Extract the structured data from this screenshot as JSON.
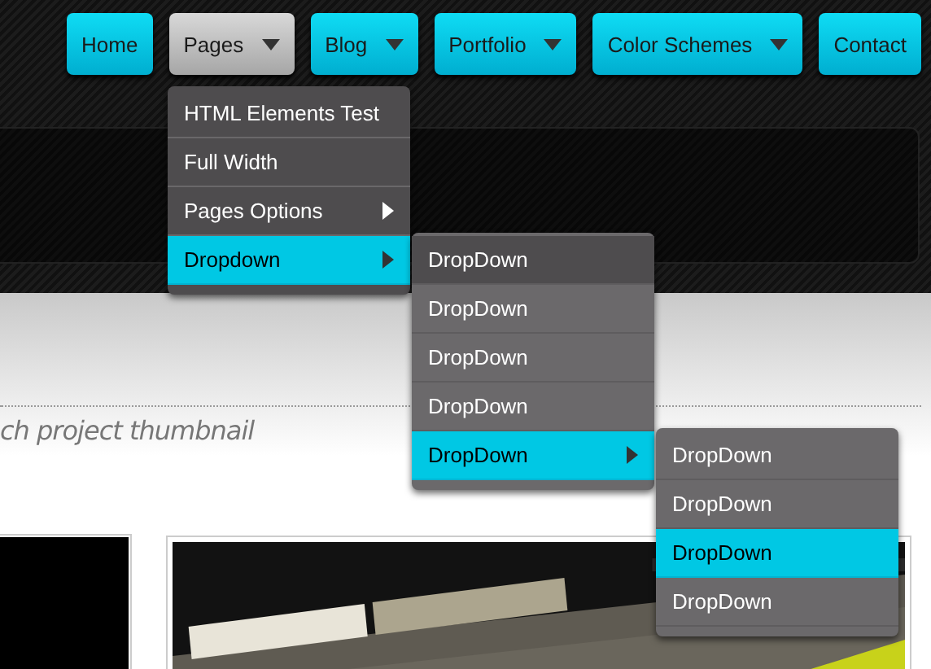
{
  "nav": [
    {
      "label": "Home",
      "selected": false,
      "has_dropdown": false
    },
    {
      "label": "Pages",
      "selected": true,
      "has_dropdown": true,
      "children": [
        {
          "label": "HTML Elements Test",
          "selected": false
        },
        {
          "label": "Full Width",
          "selected": false
        },
        {
          "label": "Pages Options",
          "selected": false,
          "has_submenu": true
        },
        {
          "label": "Dropdown",
          "selected": true,
          "children": [
            {
              "label": "DropDown",
              "selected": false
            },
            {
              "label": "DropDown",
              "selected": false
            },
            {
              "label": "DropDown",
              "selected": false
            },
            {
              "label": "DropDown",
              "selected": false
            },
            {
              "label": "DropDown",
              "selected": true,
              "children": [
                {
                  "label": "DropDown",
                  "selected": false
                },
                {
                  "label": "DropDown",
                  "selected": false
                },
                {
                  "label": "DropDown",
                  "selected": true
                },
                {
                  "label": "DropDown",
                  "selected": false
                }
              ]
            }
          ]
        }
      ]
    },
    {
      "label": "Blog",
      "selected": false,
      "has_dropdown": true
    },
    {
      "label": "Portfolio",
      "selected": false,
      "has_dropdown": true
    },
    {
      "label": "Color Schemes",
      "selected": false,
      "has_dropdown": true
    },
    {
      "label": "Contact",
      "selected": false,
      "has_dropdown": false
    }
  ],
  "caption": "ch project thumbnail",
  "thumbnails": [
    {
      "kind": "black"
    },
    {
      "kind": "picture"
    }
  ]
}
